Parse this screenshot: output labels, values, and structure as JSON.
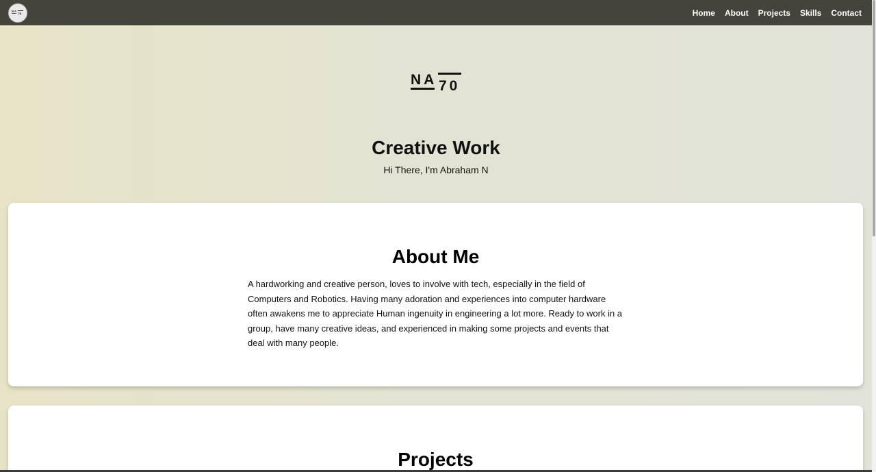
{
  "nav": {
    "logo_text": "NA70",
    "items": [
      "Home",
      "About",
      "Projects",
      "Skills",
      "Contact"
    ]
  },
  "hero": {
    "logo_text": "NA70",
    "title": "Creative Work",
    "subtitle": "Hi There, I'm Abraham N"
  },
  "about": {
    "heading": "About Me",
    "text": "A hardworking and creative person, loves to involve with tech, especially in the field of Computers and Robotics. Having many adoration and experiences into computer hardware often awakens me to appreciate Human ingenuity in engineering a lot more. Ready to work in a group, have many creative ideas, and experienced in making some projects and events that deal with many people."
  },
  "projects": {
    "heading": "Projects"
  },
  "colors": {
    "navbar": "#44443c",
    "background": "#e2e3d2",
    "card": "#ffffff"
  }
}
